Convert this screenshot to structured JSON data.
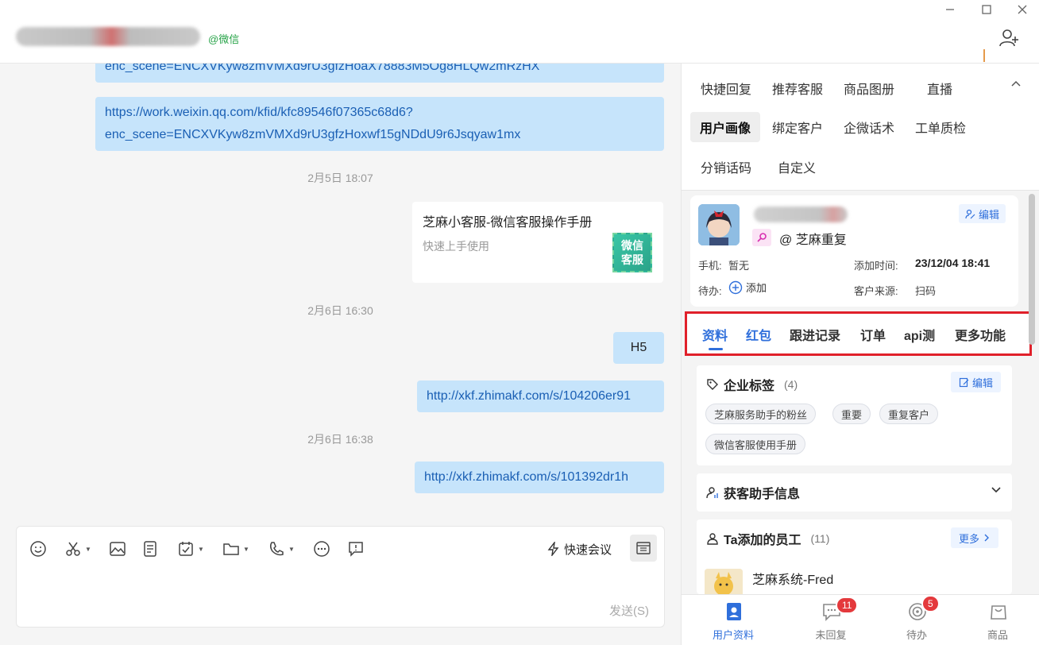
{
  "header": {
    "source_label": "@微信"
  },
  "chat": {
    "messages": [
      {
        "text": "enc_scene=ENCXVKyw8zmVMXd9rU3gfzHoaX78883M5Og8HLQw2mRzHX"
      },
      {
        "line1": "https://work.weixin.qq.com/kfid/kfc89546f07365c68d6?",
        "line2": "enc_scene=ENCXVKyw8zmVMXd9rU3gfzHoxwf15gNDdU9r6Jsqyaw1mx"
      },
      {
        "text": "H5"
      },
      {
        "text": "http://xkf.zhimakf.com/s/104206er91"
      },
      {
        "text": "http://xkf.zhimakf.com/s/101392dr1h"
      }
    ],
    "times": [
      "2月5日 18:07",
      "2月6日 16:30",
      "2月6日 16:38"
    ],
    "card": {
      "title": "芝麻小客服-微信客服操作手册",
      "subtitle": "快速上手使用",
      "thumb_line1": "微信",
      "thumb_line2": "客服"
    }
  },
  "composer": {
    "quick_meeting": "快速会议",
    "send": "发送(S)"
  },
  "side": {
    "quick_tabs": [
      "快捷回复",
      "推荐客服",
      "商品图册",
      "直播",
      "用户画像",
      "绑定客户",
      "企微话术",
      "工单质检",
      "分销话码",
      "自定义"
    ],
    "profile": {
      "corp": "@ 芝麻重复",
      "edit": "编辑",
      "phone_label": "手机:",
      "phone_value": "暂无",
      "added_label": "添加时间:",
      "added_value": "23/12/04 18:41",
      "todo_label": "待办:",
      "todo_add": "添加",
      "source_label": "客户来源:",
      "source_value": "扫码"
    },
    "profile_tabs": [
      "资料",
      "红包",
      "跟进记录",
      "订单",
      "api测",
      "更多功能"
    ],
    "enterprise_tags": {
      "title": "企业标签",
      "count": "(4)",
      "edit": "编辑",
      "tags": [
        "芝麻服务助手的粉丝",
        "重要",
        "重复客户",
        "微信客服使用手册"
      ]
    },
    "acquire_info": {
      "title": "获客助手信息"
    },
    "staff": {
      "title": "Ta添加的员工",
      "count": "(11)",
      "more": "更多",
      "first_name": "芝麻系统-Fred"
    },
    "bottom_nav": [
      {
        "label": "用户资料",
        "badge": ""
      },
      {
        "label": "未回复",
        "badge": "11"
      },
      {
        "label": "待办",
        "badge": "5"
      },
      {
        "label": "商品",
        "badge": ""
      }
    ]
  },
  "colors": {
    "accent": "#2f6fdb",
    "bubble": "#c6e4fb",
    "highlight_border": "#e0202a",
    "badge": "#e4393c",
    "wechat_green": "#27a348"
  }
}
